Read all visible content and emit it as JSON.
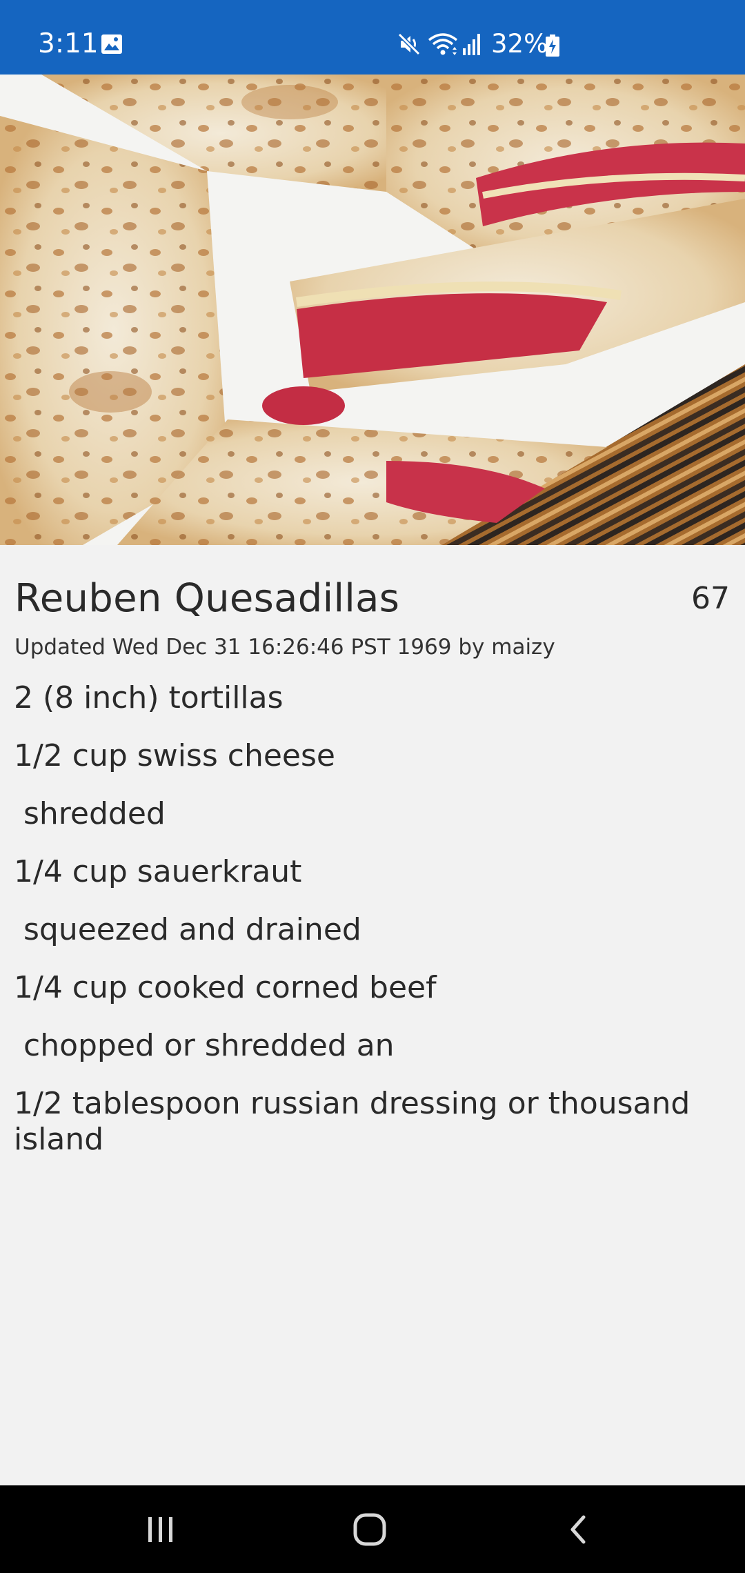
{
  "status_bar": {
    "time": "3:11",
    "battery_percent": "32%",
    "icons": [
      "gallery-icon",
      "mute-icon",
      "wifi-icon",
      "signal-icon",
      "battery-charging-icon"
    ],
    "background_color": "#1565c0"
  },
  "hero": {
    "icon": "recipe-photo"
  },
  "recipe": {
    "title": "Reuben Quesadillas",
    "count": "67",
    "meta": "Updated Wed Dec 31 16:26:46 PST 1969 by maizy",
    "ingredients": [
      "2 (8 inch) tortillas",
      "1/2 cup swiss cheese",
      " shredded",
      "1/4 cup sauerkraut",
      " squeezed and drained",
      "1/4 cup cooked corned beef",
      " chopped or shredded an",
      "1/2 tablespoon russian dressing or thousand island"
    ]
  },
  "nav_bar": {
    "icons": [
      "recent-apps-icon",
      "home-icon",
      "back-icon"
    ]
  }
}
